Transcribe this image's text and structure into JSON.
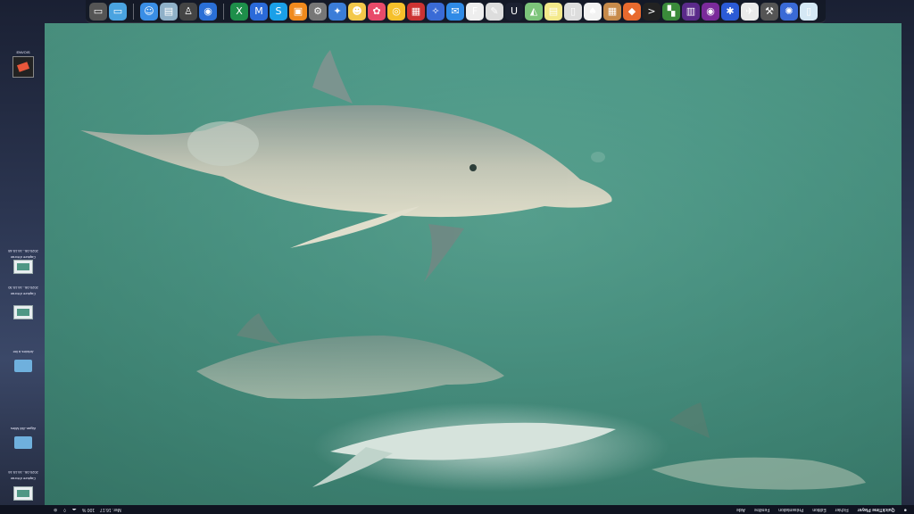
{
  "dock": {
    "icons": [
      {
        "name": "trash-icon",
        "bg": "#555",
        "glyph": "▭"
      },
      {
        "name": "desktop-icon",
        "bg": "#4aa3e0",
        "glyph": "▭"
      },
      {
        "sep": true
      },
      {
        "name": "finder-icon",
        "bg": "#3a8ee6",
        "glyph": "☺"
      },
      {
        "name": "preview-icon",
        "bg": "#8fb0c8",
        "glyph": "▤"
      },
      {
        "name": "script-icon",
        "bg": "#444",
        "glyph": "♙"
      },
      {
        "name": "safari-icon",
        "bg": "#2a6fd6",
        "glyph": "◉"
      },
      {
        "sep": true
      },
      {
        "name": "excel-icon",
        "bg": "#1e8f4a",
        "glyph": "X"
      },
      {
        "name": "word-icon",
        "bg": "#2b6ad9",
        "glyph": "M"
      },
      {
        "name": "skype-icon",
        "bg": "#1aa0e8",
        "glyph": "S"
      },
      {
        "name": "books-icon",
        "bg": "#f08a1d",
        "glyph": "▣"
      },
      {
        "name": "utility-icon",
        "bg": "#777",
        "glyph": "⚙"
      },
      {
        "name": "app-icon",
        "bg": "#3b7dd8",
        "glyph": "✦"
      },
      {
        "name": "face-icon",
        "bg": "#f3c84a",
        "glyph": "☻"
      },
      {
        "name": "photos-icon",
        "bg": "#e84b6a",
        "glyph": "✿"
      },
      {
        "name": "chrome-icon",
        "bg": "#f5c02b",
        "glyph": "◎"
      },
      {
        "name": "calculator-icon",
        "bg": "#c33",
        "glyph": "▦"
      },
      {
        "name": "compass-icon",
        "bg": "#3a6bd6",
        "glyph": "✧"
      },
      {
        "name": "messages-icon",
        "bg": "#2f8ae6",
        "glyph": "✉"
      },
      {
        "name": "fontbook-icon",
        "bg": "#eee",
        "glyph": "F"
      },
      {
        "name": "textedit-icon",
        "bg": "#ddd",
        "glyph": "✎"
      },
      {
        "name": "magnet-icon",
        "bg": "#1b2030",
        "glyph": "U"
      },
      {
        "name": "maps-icon",
        "bg": "#7cc47a",
        "glyph": "◭"
      },
      {
        "name": "notes-icon",
        "bg": "#f4e98a",
        "glyph": "▤"
      },
      {
        "name": "doc-icon",
        "bg": "#ddd",
        "glyph": "▯"
      },
      {
        "name": "ink-icon",
        "bg": "#f2f2f2",
        "glyph": "♠"
      },
      {
        "name": "grid-icon",
        "bg": "#c78a4a",
        "glyph": "▦"
      },
      {
        "name": "pizza-icon",
        "bg": "#e86a2e",
        "glyph": "◆"
      },
      {
        "name": "terminal-icon",
        "bg": "#222",
        "glyph": ">"
      },
      {
        "name": "mosaic-icon",
        "bg": "#3a8a3a",
        "glyph": "▚"
      },
      {
        "name": "numbers-icon",
        "bg": "#5a2a8a",
        "glyph": "▥"
      },
      {
        "name": "radio-icon",
        "bg": "#7a2a9a",
        "glyph": "◉"
      },
      {
        "name": "network-icon",
        "bg": "#2b5bd6",
        "glyph": "✱"
      },
      {
        "name": "migration-icon",
        "bg": "#eaeaea",
        "glyph": "✈"
      },
      {
        "name": "toolbox-icon",
        "bg": "#555",
        "glyph": "⚒"
      },
      {
        "name": "siri-icon",
        "bg": "#3a6ad6",
        "glyph": "✺"
      },
      {
        "name": "file-icon",
        "bg": "#d5e8f5",
        "glyph": "▯"
      }
    ]
  },
  "desktop": {
    "items": [
      {
        "name": "desktop-item-screenshot-1",
        "label": "2020-08...16.15.48"
      },
      {
        "name": "desktop-item-screenshot-2",
        "label": "Capture d'écran"
      },
      {
        "name": "desktop-item-screenshot-3",
        "label": "2020-08...16.15.30"
      },
      {
        "name": "desktop-item-screenshot-4",
        "label": "Capture d'écran"
      },
      {
        "name": "desktop-item-folder",
        "label": "Articles à lire"
      },
      {
        "name": "desktop-item-folder-2",
        "label": "Algae–Bill Miles"
      },
      {
        "name": "desktop-item-screenshot-5",
        "label": "2020-08...16.15.16"
      },
      {
        "name": "desktop-item-screenshot-6",
        "label": "Capture d'écran"
      }
    ],
    "top_item_label": "ENVOIS"
  },
  "menubar": {
    "app": "QuickTime Player",
    "menus": [
      "Fichier",
      "Édition",
      "Présentation",
      "Fenêtre",
      "Aide"
    ],
    "clock": "Mer. 16:17",
    "battery": "100 %"
  }
}
